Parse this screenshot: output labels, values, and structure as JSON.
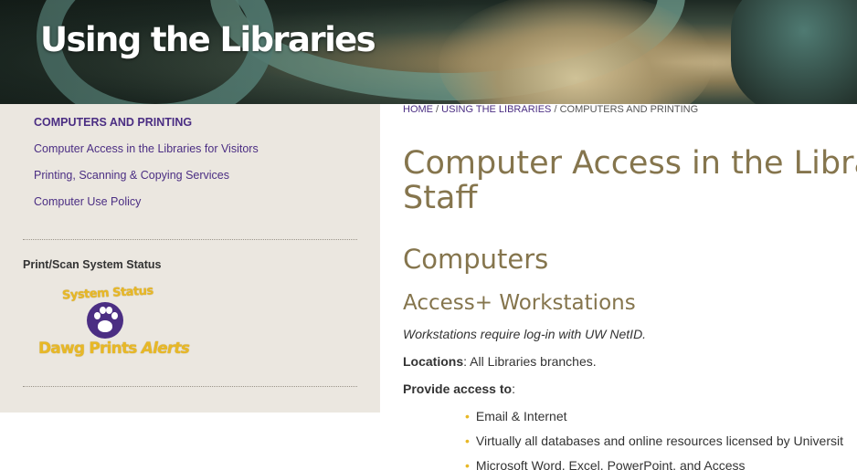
{
  "hero": {
    "title": "Using the Libraries"
  },
  "sidebar": {
    "heading": "COMPUTERS AND PRINTING",
    "links": [
      "Computer Access in the Libraries for Visitors",
      "Printing, Scanning & Copying Services",
      "Computer Use Policy"
    ],
    "status_label": "Print/Scan System Status",
    "badge": {
      "top_text": "System Status",
      "bottom_text_1": "Dawg Prints",
      "bottom_text_2": "Alerts"
    }
  },
  "breadcrumb": {
    "home": "HOME",
    "sep": " / ",
    "section": "USING THE LIBRARIES",
    "current": "COMPUTERS AND PRINTING"
  },
  "main": {
    "title_line1": "Computer Access in the Librar",
    "title_line2": "Staff",
    "h2": "Computers",
    "h3": "Access+ Workstations",
    "requirement": "Workstations require log-in with UW NetID.",
    "locations_label": "Locations",
    "locations_value": ": All Libraries branches.",
    "provide_label": "Provide access to",
    "provide_suffix": ":",
    "bullets": [
      "Email & Internet",
      "Virtually all databases and online resources licensed by Universit",
      "Microsoft Word, Excel, PowerPoint, and Access"
    ]
  },
  "colors": {
    "purple": "#4b2e83",
    "gold": "#e8b826",
    "heading_gold": "#85754d",
    "sidebar_bg": "#ebe7e0"
  }
}
